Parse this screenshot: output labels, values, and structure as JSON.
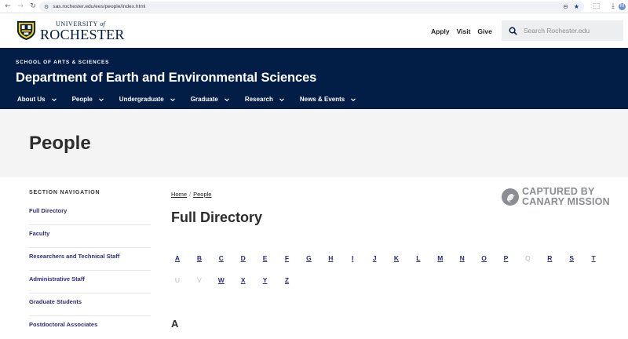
{
  "browser": {
    "url": "sas.rochester.edu/ees/people/index.html",
    "profile_initial": "M"
  },
  "header": {
    "logo_top": "UNIVERSITY",
    "logo_of": "of",
    "logo_main": "ROCHESTER",
    "util_links": [
      "Apply",
      "Visit",
      "Give"
    ],
    "search_placeholder": "Search Rochester.edu"
  },
  "department": {
    "school": "SCHOOL OF ARTS & SCIENCES",
    "title": "Department of Earth and Environmental Sciences",
    "nav": [
      "About Us",
      "People",
      "Undergraduate",
      "Graduate",
      "Research",
      "News & Events"
    ]
  },
  "page": {
    "title": "People"
  },
  "sidebar": {
    "heading": "SECTION NAVIGATION",
    "items": [
      "Full Directory",
      "Faculty",
      "Researchers and Technical Staff",
      "Administrative Staff",
      "Graduate Students",
      "Postdoctoral Associates"
    ]
  },
  "breadcrumb": [
    "Home",
    "People"
  ],
  "main": {
    "title": "Full Directory",
    "letters_row1": [
      "A",
      "B",
      "C",
      "D",
      "E",
      "F",
      "G",
      "H",
      "I",
      "J",
      "K",
      "L",
      "M",
      "N",
      "O",
      "P",
      "Q",
      "R",
      "S",
      "T"
    ],
    "letters_row2": [
      "U",
      "V",
      "W",
      "X",
      "Y",
      "Z"
    ],
    "disabled_letters": [
      "Q",
      "U",
      "V"
    ],
    "section_heading": "A"
  },
  "watermark": {
    "line1": "CAPTURED BY",
    "line2": "CANARY MISSION"
  },
  "colors": {
    "brand_navy": "#021e47",
    "link_purple": "#2f2d7a"
  }
}
